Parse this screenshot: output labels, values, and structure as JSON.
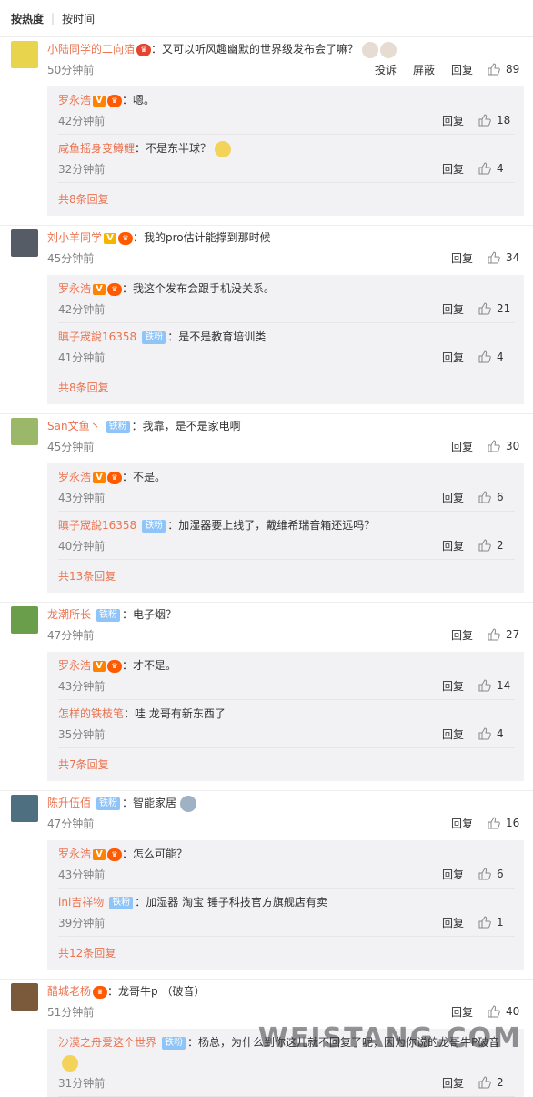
{
  "sort": {
    "hot": "按热度",
    "time": "按时间",
    "sep": "|"
  },
  "labels": {
    "report": "投诉",
    "block": "屏蔽",
    "reply": "回复"
  },
  "comments": [
    {
      "user": "小陆同学的二向箔",
      "text": "：又可以听风趣幽默的世界级发布会了嘛？",
      "time": "50分钟前",
      "likes": "89",
      "replies": [
        {
          "user": "罗永浩",
          "text": "：嗯。",
          "time": "42分钟前",
          "likes": "18"
        },
        {
          "user": "咸鱼摇身变鳟鲤",
          "text": "：不是东半球？",
          "time": "32分钟前",
          "likes": "4"
        }
      ],
      "more": "共8条回复"
    },
    {
      "user": "刘小羊同学",
      "text": "：我的pro估计能撑到那时候",
      "time": "45分钟前",
      "likes": "34",
      "replies": [
        {
          "user": "罗永浩",
          "text": "：我这个发布会跟手机没关系。",
          "time": "42分钟前",
          "likes": "21"
        },
        {
          "user": "瞋子宬說16358",
          "badge": "铁粉",
          "text": "：是不是教育培训类",
          "time": "41分钟前",
          "likes": "4"
        }
      ],
      "more": "共8条回复"
    },
    {
      "user": "San文鱼丶",
      "badge": "铁粉",
      "text": "：我靠，是不是家电啊",
      "time": "45分钟前",
      "likes": "30",
      "replies": [
        {
          "user": "罗永浩",
          "text": "：不是。",
          "time": "43分钟前",
          "likes": "6"
        },
        {
          "user": "瞋子宬說16358",
          "badge": "铁粉",
          "text": "：加湿器要上线了，戴维希瑞音箱还远吗？",
          "time": "40分钟前",
          "likes": "2"
        }
      ],
      "more": "共13条回复"
    },
    {
      "user": "龙潮所长",
      "badge": "铁粉",
      "text": "：电子烟？",
      "time": "47分钟前",
      "likes": "27",
      "replies": [
        {
          "user": "罗永浩",
          "text": "：才不是。",
          "time": "43分钟前",
          "likes": "14"
        },
        {
          "user": "怎样的铁枝笔",
          "text": "：哇 龙哥有新东西了",
          "time": "35分钟前",
          "likes": "4"
        }
      ],
      "more": "共7条回复"
    },
    {
      "user": "陈升伍佰",
      "badge": "铁粉",
      "text": "：智能家居",
      "time": "47分钟前",
      "likes": "16",
      "replies": [
        {
          "user": "罗永浩",
          "text": "：怎么可能？",
          "time": "43分钟前",
          "likes": "6"
        },
        {
          "user": "ini吉祥物",
          "badge": "铁粉",
          "text": "：加湿器 淘宝 锤子科技官方旗舰店有卖",
          "time": "39分钟前",
          "likes": "1"
        }
      ],
      "more": "共12条回复"
    },
    {
      "user": "醋城老杨",
      "text": "：龙哥牛p （破音）",
      "time": "51分钟前",
      "likes": "40",
      "replies": [
        {
          "user": "沙漠之舟爱这个世界",
          "badge": "铁粉",
          "text": "：杨总，为什么到你这儿就不回复了呢，因为你说的龙哥牛P破音",
          "time": "31分钟前",
          "likes": "2"
        }
      ]
    }
  ],
  "watermark": "WEISTANG.COM",
  "colors": {
    "username": "#eb7350",
    "reply_bg": "#f2f2f5",
    "tiefen_badge": "#8ec4f7",
    "verified": "#ff8200"
  }
}
